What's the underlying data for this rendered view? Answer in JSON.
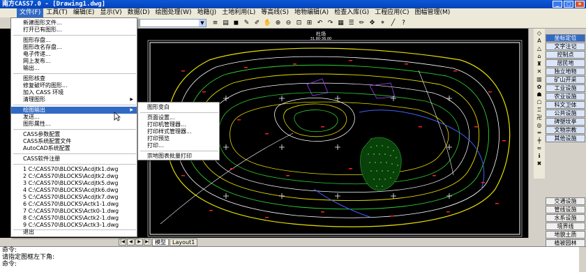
{
  "window": {
    "title": "南方CASS7.0 - [Drawing1.dwg]",
    "buttons": [
      "_",
      "□",
      "×"
    ]
  },
  "menubar": {
    "items": [
      {
        "label": "文件(F)",
        "active": true
      },
      {
        "label": "工具(T)"
      },
      {
        "label": "编辑(E)"
      },
      {
        "label": "显示(V)"
      },
      {
        "label": "数据(D)"
      },
      {
        "label": "绘图处理(W)"
      },
      {
        "label": "地籍(J)"
      },
      {
        "label": "土地利用(L)"
      },
      {
        "label": "等高线(S)"
      },
      {
        "label": "地物编辑(A)"
      },
      {
        "label": "检查入库(G)"
      },
      {
        "label": "工程应用(C)"
      },
      {
        "label": "图幅管理(M)"
      }
    ]
  },
  "file_menu": {
    "groups": [
      [
        "新建图形文件...",
        "打开已有图形..."
      ],
      [
        "图形存盘...",
        "图形改名存盘...",
        "电子传递...",
        "网上发布...",
        "输出..."
      ],
      [
        "图形核查",
        "修复破坏的图形...",
        "加入 CASS 环境",
        "清理图形"
      ],
      [
        "绘图输出",
        "发送...",
        "图形属性..."
      ],
      [
        "CASS参数配置",
        "CASS系统配置文件",
        "AutoCAD系统配置"
      ],
      [
        "CASS软件注册"
      ],
      [
        "1 C:\\CASS70\\BLOCKS\\Acdjtk1.dwg",
        "2 C:\\CASS70\\BLOCKS\\Acdjtk2.dwg",
        "3 C:\\CASS70\\BLOCKS\\Acdjtk5.dwg",
        "4 C:\\CASS70\\BLOCKS\\Acdjtk6.dwg",
        "5 C:\\CASS70\\BLOCKS\\Acdjtk7.dwg",
        "6 C:\\CASS70\\BLOCKS\\Actk1-1.dwg",
        "7 C:\\CASS70\\BLOCKS\\Actk0-1.dwg",
        "8 C:\\CASS70\\BLOCKS\\Actk2-1.dwg",
        "9 C:\\CASS70\\BLOCKS\\Actk3-1.dwg"
      ],
      [
        "退出"
      ]
    ],
    "highlighted": "绘图输出"
  },
  "submenu": {
    "items": [
      "图形变白",
      "页面设置...",
      "打印机管理器...",
      "打印样式管理器...",
      "打印预览",
      "打印...",
      "宗地图表批量打印"
    ]
  },
  "drawing": {
    "title_line1": "杜场",
    "title_line2": "31.80-36.00"
  },
  "layout_tabs": [
    "模型",
    "Layout1"
  ],
  "right_panel": {
    "top_buttons": [
      "坐标定位",
      "文字注记",
      "控制点",
      "居民地",
      "独立地物",
      "矿山开采",
      "工业设施",
      "农业设施",
      "科文卫体",
      "公共设施",
      "碑塑坟亭",
      "文物宗教",
      "其他设施"
    ],
    "bottom_buttons": [
      "交通设施",
      "管线设施",
      "水系设施",
      "境界线",
      "地貌土质",
      "植被园林"
    ],
    "selected": "坐标定位"
  },
  "command": {
    "lines": [
      "命令:",
      "请指定图框左下角:",
      "命令:"
    ]
  },
  "colors": {
    "titlebar": "#0842b4",
    "menu_highlight": "#316ac5",
    "contour_yellow": "#e8e000",
    "contour_green": "#30d030",
    "contour_white": "#ffffff",
    "contour_red": "#ff2020",
    "contour_blue": "#4060ff"
  }
}
